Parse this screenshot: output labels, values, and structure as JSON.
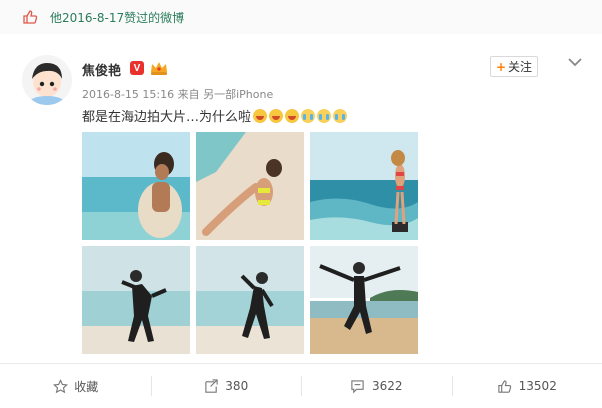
{
  "liked_header": {
    "text": "他2016-8-17赞过的微博"
  },
  "post": {
    "username": "焦俊艳",
    "verified_badge": "V",
    "follow_label": "关注",
    "follow_plus": "+",
    "meta": "2016-8-15 15:16 来自 另一部iPhone",
    "text": "都是在海边拍大片…为什么啦",
    "emojis": [
      "laugh",
      "laugh",
      "laugh",
      "cry",
      "cry",
      "cry"
    ]
  },
  "photos": [
    {
      "name": "photo-1-woman-in-sea"
    },
    {
      "name": "photo-2-woman-on-sand"
    },
    {
      "name": "photo-3-woman-on-rock"
    },
    {
      "name": "photo-4-man-dancing"
    },
    {
      "name": "photo-5-man-dancing"
    },
    {
      "name": "photo-6-man-jumping"
    }
  ],
  "actions": {
    "favorite_label": "收藏",
    "repost_count": "380",
    "comment_count": "3622",
    "like_count": "13502"
  },
  "colors": {
    "accent_green": "#2a7c5c",
    "follow_plus": "#ff8200",
    "verified_red": "#e8322b"
  }
}
